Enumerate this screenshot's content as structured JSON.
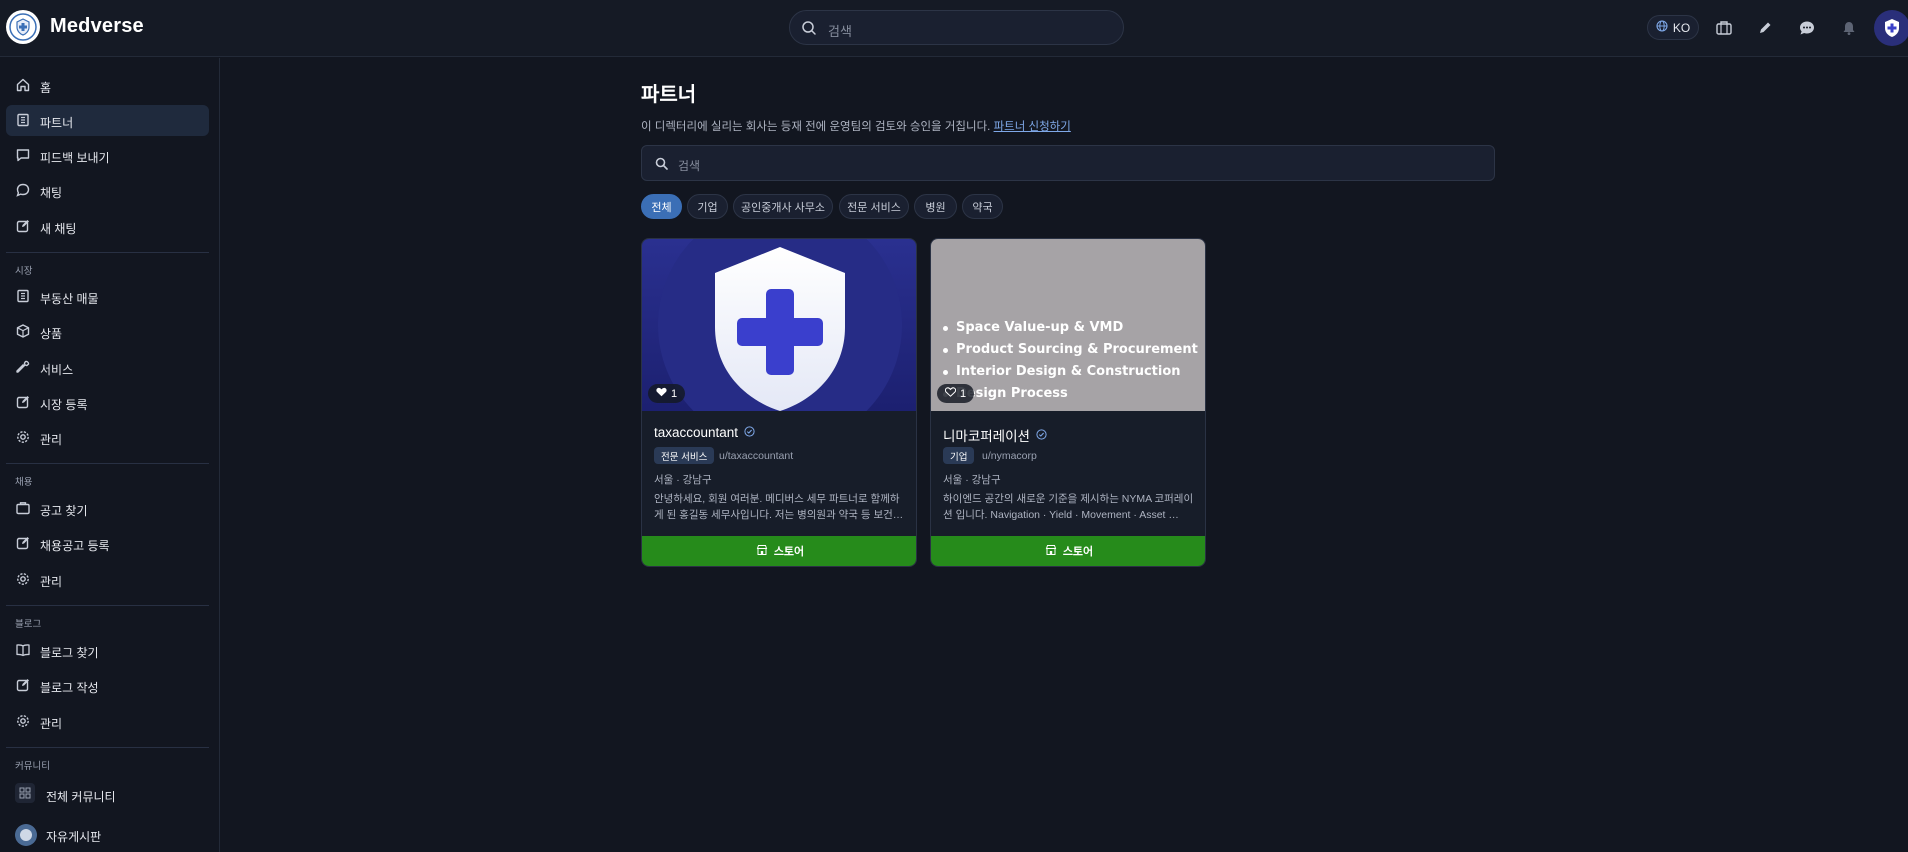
{
  "app": {
    "brand": "Medverse"
  },
  "header": {
    "search_placeholder": "검색",
    "lang": "KO"
  },
  "sidebar": {
    "main_items": [
      {
        "label": "홈",
        "icon": "home-icon"
      },
      {
        "label": "파트너",
        "icon": "building-icon",
        "active": true
      },
      {
        "label": "피드백 보내기",
        "icon": "message-square-icon"
      },
      {
        "label": "채팅",
        "icon": "chat-bubble-icon"
      },
      {
        "label": "새 채팅",
        "icon": "edit-icon"
      }
    ],
    "market": {
      "title": "시장",
      "items": [
        {
          "label": "부동산 매물",
          "icon": "building-icon"
        },
        {
          "label": "상품",
          "icon": "box-icon"
        },
        {
          "label": "서비스",
          "icon": "wrench-icon"
        },
        {
          "label": "시장 등록",
          "icon": "edit-icon"
        },
        {
          "label": "관리",
          "icon": "gear-icon"
        }
      ]
    },
    "jobs": {
      "title": "채용",
      "items": [
        {
          "label": "공고 찾기",
          "icon": "briefcase-icon"
        },
        {
          "label": "채용공고 등록",
          "icon": "edit-icon"
        },
        {
          "label": "관리",
          "icon": "gear-icon"
        }
      ]
    },
    "blog": {
      "title": "블로그",
      "items": [
        {
          "label": "블로그 찾기",
          "icon": "book-icon"
        },
        {
          "label": "블로그 작성",
          "icon": "edit-icon"
        },
        {
          "label": "관리",
          "icon": "gear-icon"
        }
      ]
    },
    "community": {
      "title": "커뮤니티",
      "items": [
        {
          "label": "전체 커뮤니티",
          "icon": "grid-icon"
        },
        {
          "label": "자유게시판",
          "icon": "avatar"
        }
      ]
    }
  },
  "main": {
    "title": "파트너",
    "description": "이 디렉터리에 실리는 회사는 등재 전에 운영팀의 검토와 승인을 거칩니다.",
    "apply_link": "파트너 신청하기",
    "search_placeholder": "검색",
    "filters": [
      "전체",
      "기업",
      "공인중개사 사무소",
      "전문 서비스",
      "병원",
      "약국"
    ],
    "active_filter": "전체",
    "cards": [
      {
        "name": "taxaccountant",
        "badge": "전문 서비스",
        "handle": "u/taxaccountant",
        "location": "서울 · 강남구",
        "description": "안녕하세요, 회원 여러분. 메디버스 세무 파트너로 함께하게 된 홍길동 세무사입니다. 저는 병의원과 약국 등 보건의료 …",
        "likes": "1",
        "store_label": "스토어"
      },
      {
        "name": "니마코퍼레이션",
        "badge": "기업",
        "handle": "u/nymacorp",
        "location": "서울 · 강남구",
        "description": "하이엔드 공간의 새로운 기준을 제시하는 NYMA 코퍼레이션 입니다. Navigation · Yield · Movement · Asset …",
        "likes": "1",
        "store_label": "스토어",
        "image_lines": [
          "Space Value-up & VMD",
          "Product Sourcing & Procurement",
          "Interior Design & Construction",
          "Design Process"
        ]
      }
    ]
  },
  "colors": {
    "background": "#121620",
    "accent": "#3b6fb6",
    "store_button": "#268b1b",
    "link": "#7fa8e8"
  }
}
